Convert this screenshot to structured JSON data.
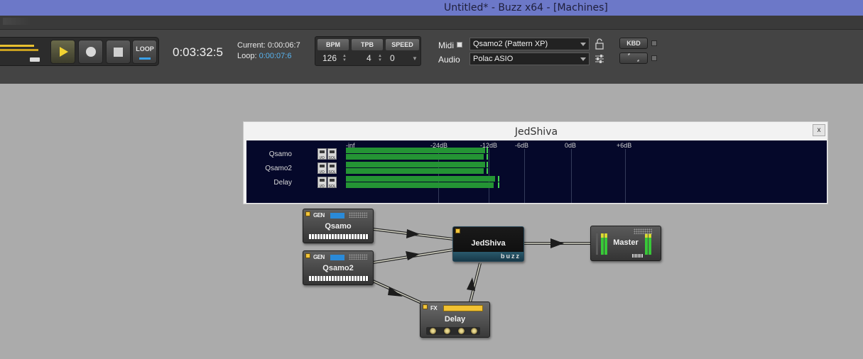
{
  "window": {
    "title": "Untitled* - Buzz x64 - [Machines]"
  },
  "transport": {
    "loop_label": "LOOP",
    "time": "0:03:32:5",
    "current_label": "Current:",
    "current_value": "0:00:06:7",
    "loop_pos_label": "Loop:",
    "loop_pos_value": "0:00:07:6"
  },
  "tempo": {
    "bpm_label": "BPM",
    "bpm": "126",
    "tpb_label": "TPB",
    "tpb": "4",
    "speed_label": "SPEED",
    "speed": "0"
  },
  "devices": {
    "midi_label": "Midi",
    "midi_device": "Qsamo2 (Pattern XP)",
    "audio_label": "Audio",
    "audio_driver": "Polac ASIO",
    "kbd_label": "KBD"
  },
  "mixer_panel": {
    "title": "JedShiva",
    "close": "x",
    "scale": [
      "-inf",
      "-24dB",
      "-12dB",
      "-6dB",
      "0dB",
      "+6dB"
    ],
    "channels": [
      {
        "name": "Qsamo",
        "level": 0.29
      },
      {
        "name": "Qsamo2",
        "level": 0.29
      },
      {
        "name": "Delay",
        "level": 0.31
      }
    ],
    "io_label": "I/O",
    "sol_label": "SOL"
  },
  "machines": {
    "gen_tag": "GEN",
    "fx_tag": "FX",
    "qsamo": "Qsamo",
    "qsamo2": "Qsamo2",
    "jedshiva": "JedShiva",
    "jedshiva_brand": "buzz",
    "delay": "Delay",
    "master": "Master"
  },
  "colors": {
    "titlebar": "#6c78c8",
    "toolbar": "#444444",
    "canvas": "#ababab",
    "accent": "#58b4f0",
    "play": "#f1d232",
    "meter_green": "#2fae3e",
    "led": "#f2c53a"
  }
}
